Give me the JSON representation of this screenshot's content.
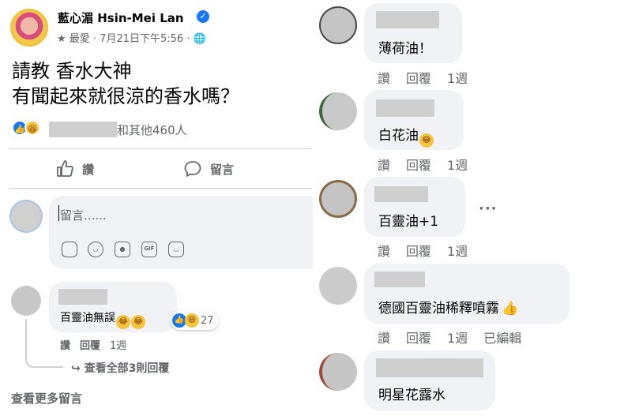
{
  "post": {
    "author": "藍心湄 Hsin-Mei Lan",
    "meta": "★ 最愛 · 7月21日下午5:56 · 🌐",
    "text_line1": "請教 香水大神",
    "text_line2": "有聞起來就很涼的香水嗎？",
    "reactions_suffix": "和其他460人",
    "like_label": "讚",
    "comment_label": "留言"
  },
  "composer": {
    "placeholder": "留言......",
    "tools": [
      "sticker-icon",
      "emoji-icon",
      "camera-icon",
      "gif-icon",
      "sticker-face-icon"
    ],
    "gif_label": "GIF"
  },
  "left_comment": {
    "text": "百靈油無誤",
    "reaction_count": "27",
    "actions": [
      "讚",
      "回覆",
      "1週"
    ],
    "view_replies": "↪ 查看全部3則回覆"
  },
  "more_comments": "查看更多留言",
  "right_comments": [
    {
      "text": "薄荷油！",
      "actions": [
        "讚",
        "回覆",
        "1週"
      ]
    },
    {
      "text": "白花油",
      "actions": [
        "讚",
        "回覆",
        "1週"
      ]
    },
    {
      "text": "百靈油+1",
      "actions": [
        "讚",
        "回覆",
        "1週"
      ]
    },
    {
      "text": "德國百靈油稀釋噴霧",
      "actions": [
        "讚",
        "回覆",
        "1週",
        "已編輯"
      ]
    },
    {
      "text": "明星花露水",
      "actions": [
        "讚",
        "回覆",
        "1週"
      ]
    }
  ],
  "more_dots": "···",
  "colors": {
    "accent": "#1877f2",
    "bubble": "#f0f2f5",
    "secondary_text": "#65676b",
    "divider": "#ced0d4"
  }
}
